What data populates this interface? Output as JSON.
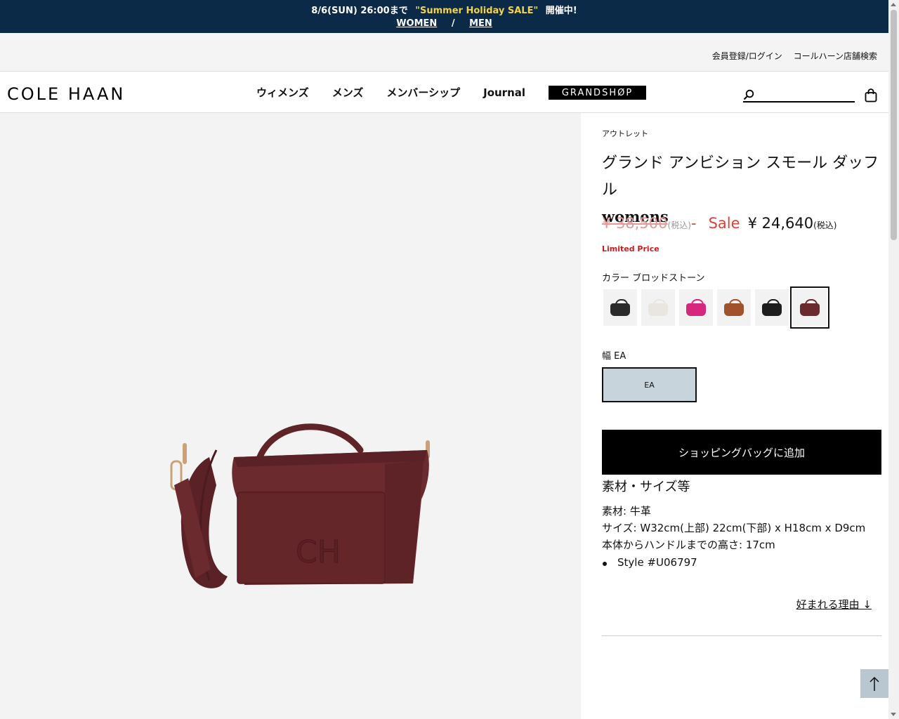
{
  "promo": {
    "date_text": "8/6(SUN) 26:00まで",
    "sale_text": "\"Summer Holiday SALE\"",
    "suffix_text": "開催中!",
    "women_link": "WOMEN",
    "separator": "/",
    "men_link": "MEN"
  },
  "utility": {
    "login": "会員登録/ログイン",
    "store_search": "コールハーン店舗検索"
  },
  "header": {
    "logo": "COLE HAAN",
    "nav": [
      "ウィメンズ",
      "メンズ",
      "メンバーシップ",
      "Journal"
    ],
    "grandshop": "GRANDSHØP",
    "search_placeholder": ""
  },
  "product": {
    "category": "アウトレット",
    "title": "グランド アンビション スモール ダッフル",
    "subtitle": "womens",
    "original_price": "¥ 38,500",
    "original_tax": "(税込)",
    "dash": "-",
    "sale_label": "Sale",
    "sale_price": "¥ 24,640",
    "sale_tax": "(税込)",
    "limited": "Limited Price",
    "color_label": "カラー ブロッドストーン",
    "swatches": [
      {
        "name": "black",
        "color": "#2b2b2b"
      },
      {
        "name": "white",
        "color": "#e9e6df"
      },
      {
        "name": "pink",
        "color": "#d7267d"
      },
      {
        "name": "brown",
        "color": "#a0522d"
      },
      {
        "name": "black-2",
        "color": "#1e1e1e"
      },
      {
        "name": "bloodstone",
        "color": "#6a2a2e"
      }
    ],
    "selected_swatch": 5,
    "width_label": "幅 EA",
    "width_option": "EA",
    "add_to_bag": "ショッピングバッグに追加",
    "spec_title": "素材・サイズ等",
    "spec_material": "素材: 牛革",
    "spec_size": "サイズ: W32cm(上部) 22cm(下部) x H18cm x D9cm",
    "spec_handle": "本体からハンドルまでの高さ: 17cm",
    "style_number": "Style #U06797",
    "reason_link": "好まれる理由 ↓"
  },
  "colors": {
    "promo_bg": "#0b2a47",
    "promo_highlight": "#f2d34b",
    "sale_red": "#d9443c",
    "limited_red": "#c81c1c",
    "bag_burgundy": "#6a2a2e"
  }
}
